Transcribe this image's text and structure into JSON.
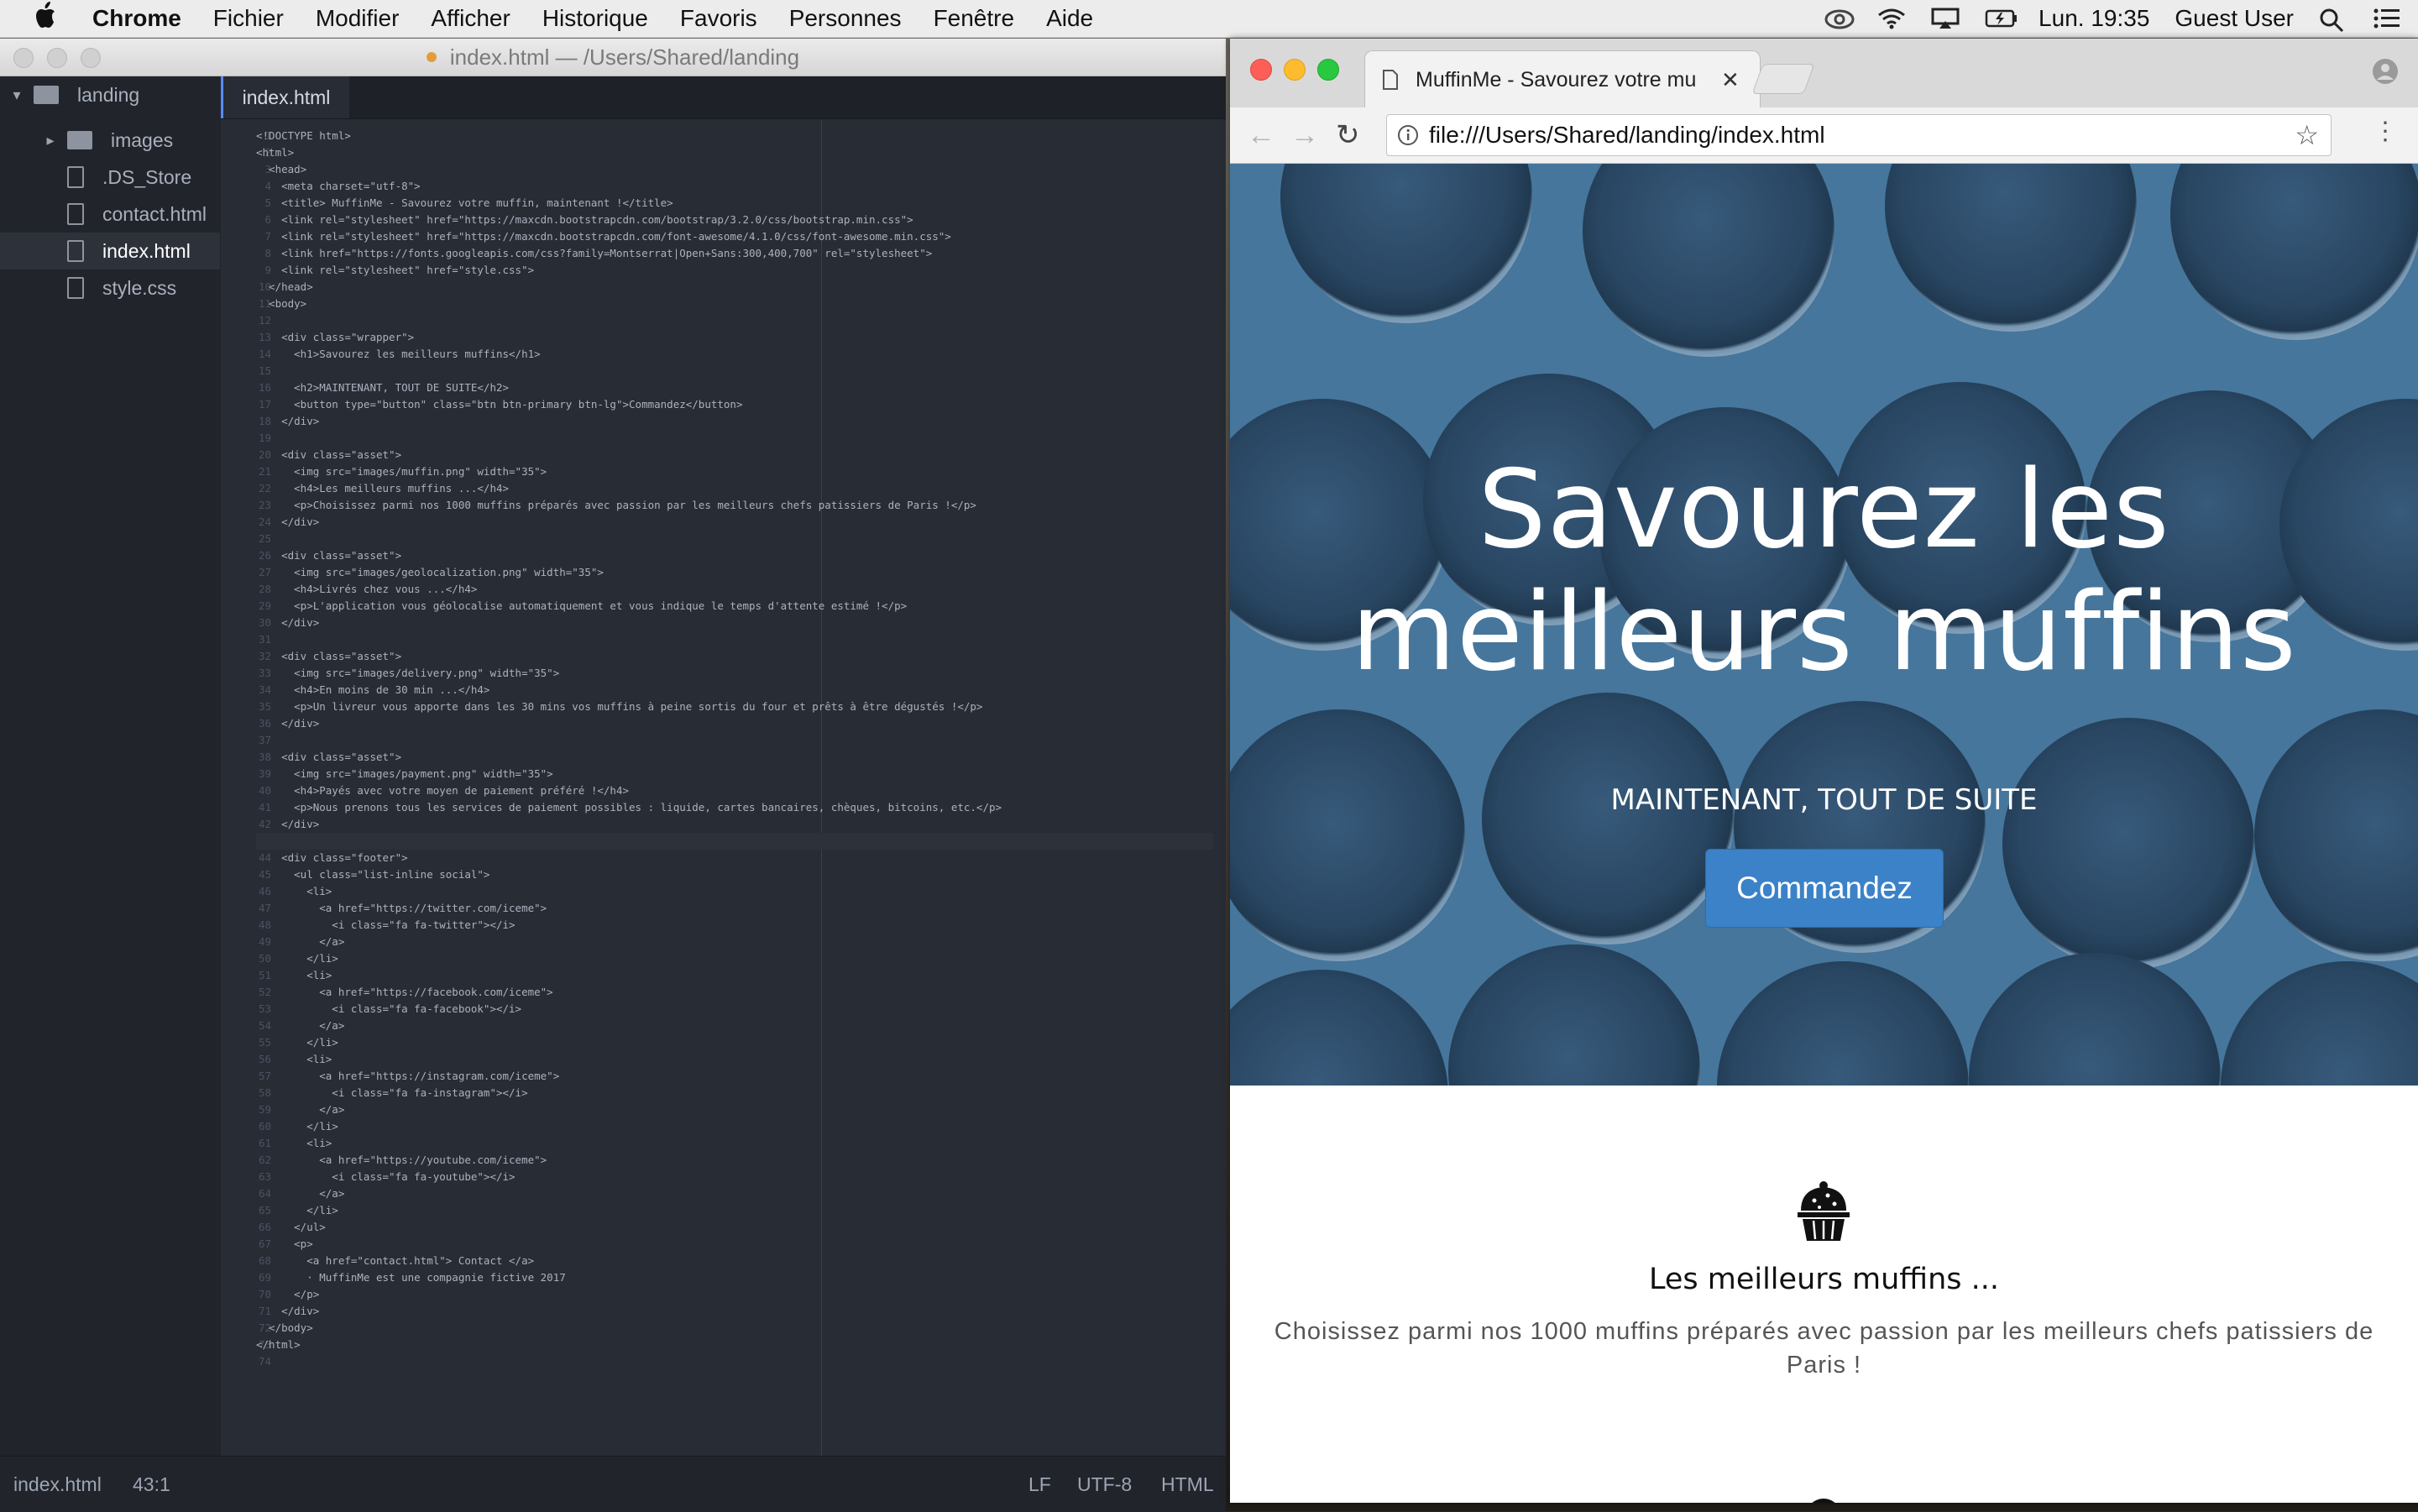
{
  "menubar": {
    "app": "Chrome",
    "items": [
      "Fichier",
      "Modifier",
      "Afficher",
      "Historique",
      "Favoris",
      "Personnes",
      "Fenêtre",
      "Aide"
    ],
    "clock": "Lun. 19:35",
    "user": "Guest User"
  },
  "editor": {
    "window_title": "index.html — /Users/Shared/landing",
    "tree": {
      "root": "landing",
      "items": [
        "images",
        ".DS_Store",
        "contact.html",
        "index.html",
        "style.css"
      ]
    },
    "tab": "index.html",
    "code_lines": [
      "<!DOCTYPE html>",
      "<html>",
      "  <head>",
      "    <meta charset=\"utf-8\">",
      "    <title> MuffinMe - Savourez votre muffin, maintenant !</title>",
      "    <link rel=\"stylesheet\" href=\"https://maxcdn.bootstrapcdn.com/bootstrap/3.2.0/css/bootstrap.min.css\">",
      "    <link rel=\"stylesheet\" href=\"https://maxcdn.bootstrapcdn.com/font-awesome/4.1.0/css/font-awesome.min.css\">",
      "    <link href=\"https://fonts.googleapis.com/css?family=Montserrat|Open+Sans:300,400,700\" rel=\"stylesheet\">",
      "    <link rel=\"stylesheet\" href=\"style.css\">",
      "  </head>",
      "  <body>",
      "",
      "    <div class=\"wrapper\">",
      "      <h1>Savourez les meilleurs muffins</h1>",
      "",
      "      <h2>MAINTENANT, TOUT DE SUITE</h2>",
      "      <button type=\"button\" class=\"btn btn-primary btn-lg\">Commandez</button>",
      "    </div>",
      "",
      "    <div class=\"asset\">",
      "      <img src=\"images/muffin.png\" width=\"35\">",
      "      <h4>Les meilleurs muffins ...</h4>",
      "      <p>Choisissez parmi nos 1000 muffins préparés avec passion par les meilleurs chefs patissiers de Paris !</p>",
      "    </div>",
      "",
      "    <div class=\"asset\">",
      "      <img src=\"images/geolocalization.png\" width=\"35\">",
      "      <h4>Livrés chez vous ...</h4>",
      "      <p>L'application vous géolocalise automatiquement et vous indique le temps d'attente estimé !</p>",
      "    </div>",
      "",
      "    <div class=\"asset\">",
      "      <img src=\"images/delivery.png\" width=\"35\">",
      "      <h4>En moins de 30 min ...</h4>",
      "      <p>Un livreur vous apporte dans les 30 mins vos muffins à peine sortis du four et prêts à être dégustés !</p>",
      "    </div>",
      "",
      "    <div class=\"asset\">",
      "      <img src=\"images/payment.png\" width=\"35\">",
      "      <h4>Payés avec votre moyen de paiement préféré !</h4>",
      "      <p>Nous prenons tous les services de paiement possibles : liquide, cartes bancaires, chèques, bitcoins, etc.</p>",
      "    </div>",
      "",
      "    <div class=\"footer\">",
      "      <ul class=\"list-inline social\">",
      "        <li>",
      "          <a href=\"https://twitter.com/iceme\">",
      "            <i class=\"fa fa-twitter\"></i>",
      "          </a>",
      "        </li>",
      "        <li>",
      "          <a href=\"https://facebook.com/iceme\">",
      "            <i class=\"fa fa-facebook\"></i>",
      "          </a>",
      "        </li>",
      "        <li>",
      "          <a href=\"https://instagram.com/iceme\">",
      "            <i class=\"fa fa-instagram\"></i>",
      "          </a>",
      "        </li>",
      "        <li>",
      "          <a href=\"https://youtube.com/iceme\">",
      "            <i class=\"fa fa-youtube\"></i>",
      "          </a>",
      "        </li>",
      "      </ul>",
      "      <p>",
      "        <a href=\"contact.html\"> Contact </a>",
      "        · MuffinMe est une compagnie fictive 2017",
      "      </p>",
      "    </div>",
      "  </body>",
      "</html>",
      ""
    ],
    "current_line": 43,
    "status": {
      "file": "index.html",
      "cursor": "43:1",
      "eol": "LF",
      "encoding": "UTF-8",
      "grammar": "HTML"
    }
  },
  "browser": {
    "tab_title": "MuffinMe - Savourez votre mu",
    "url": "file:///Users/Shared/landing/index.html",
    "page": {
      "hero_title": "Savourez les meilleurs muffins",
      "hero_subtitle": "MAINTENANT, TOUT DE SUITE",
      "cta": "Commandez",
      "feature_title": "Les meilleurs muffins ...",
      "feature_text": "Choisissez parmi nos 1000 muffins préparés avec passion par les meilleurs chefs patissiers de Paris !"
    }
  },
  "colors": {
    "accent": "#3b82c8",
    "editor_bg": "#282c34",
    "hero": "#4f7fa5"
  },
  "icons": [
    "apple-icon",
    "creative-cloud-icon",
    "wifi-icon",
    "airplay-icon",
    "battery-icon",
    "spotlight-icon",
    "notification-center-icon",
    "folder-icon",
    "file-icon",
    "page-icon",
    "back-icon",
    "forward-icon",
    "reload-icon",
    "info-icon",
    "star-icon",
    "menu-dots-icon",
    "profile-icon",
    "muffin-icon",
    "location-pin-icon"
  ]
}
